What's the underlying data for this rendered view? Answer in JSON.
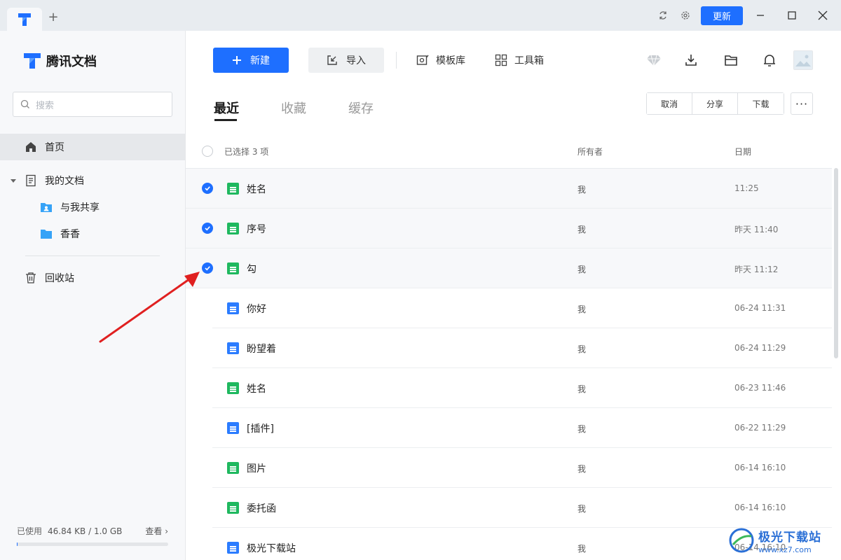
{
  "titlebar": {
    "add_tab": "+",
    "update_label": "更新"
  },
  "brand": {
    "name": "腾讯文档"
  },
  "search": {
    "placeholder": "搜索"
  },
  "sidebar": {
    "home": "首页",
    "my_docs": "我的文档",
    "shared": "与我共享",
    "folder": "香香",
    "trash": "回收站"
  },
  "storage": {
    "label": "已使用",
    "value": "46.84 KB / 1.0 GB",
    "view": "查看 ›"
  },
  "toolbar": {
    "new_label": "新建",
    "import_label": "导入",
    "templates_label": "模板库",
    "toolbox_label": "工具箱"
  },
  "tabs": [
    "最近",
    "收藏",
    "缓存"
  ],
  "actions": {
    "cancel": "取消",
    "share": "分享",
    "download": "下载",
    "more": "···"
  },
  "list_header": {
    "selected": "已选择 3 项",
    "owner": "所有者",
    "date": "日期"
  },
  "rows": [
    {
      "name": "姓名",
      "type": "sheet",
      "owner": "我",
      "date": "11:25",
      "selected": true
    },
    {
      "name": "序号",
      "type": "sheet",
      "owner": "我",
      "date": "昨天 11:40",
      "selected": true
    },
    {
      "name": "勾",
      "type": "sheet",
      "owner": "我",
      "date": "昨天 11:12",
      "selected": true
    },
    {
      "name": "你好",
      "type": "doc",
      "owner": "我",
      "date": "06-24 11:31",
      "selected": false
    },
    {
      "name": "盼望着",
      "type": "doc",
      "owner": "我",
      "date": "06-24 11:29",
      "selected": false
    },
    {
      "name": "姓名",
      "type": "sheet",
      "owner": "我",
      "date": "06-23 11:46",
      "selected": false
    },
    {
      "name": "[插件]",
      "type": "doc",
      "owner": "我",
      "date": "06-22 11:29",
      "selected": false
    },
    {
      "name": "图片",
      "type": "sheet",
      "owner": "我",
      "date": "06-14 16:10",
      "selected": false
    },
    {
      "name": "委托函",
      "type": "sheet",
      "owner": "我",
      "date": "06-14 16:10",
      "selected": false
    },
    {
      "name": "极光下载站",
      "type": "doc",
      "owner": "我",
      "date": "06-14 16:10",
      "selected": false
    }
  ],
  "watermark": {
    "title": "极光下载站",
    "url": "www.xz7.com"
  },
  "colors": {
    "accent": "#1e6fff",
    "sheet": "#1fb85f",
    "doc": "#2b7cff",
    "annotation": "#e02020"
  }
}
